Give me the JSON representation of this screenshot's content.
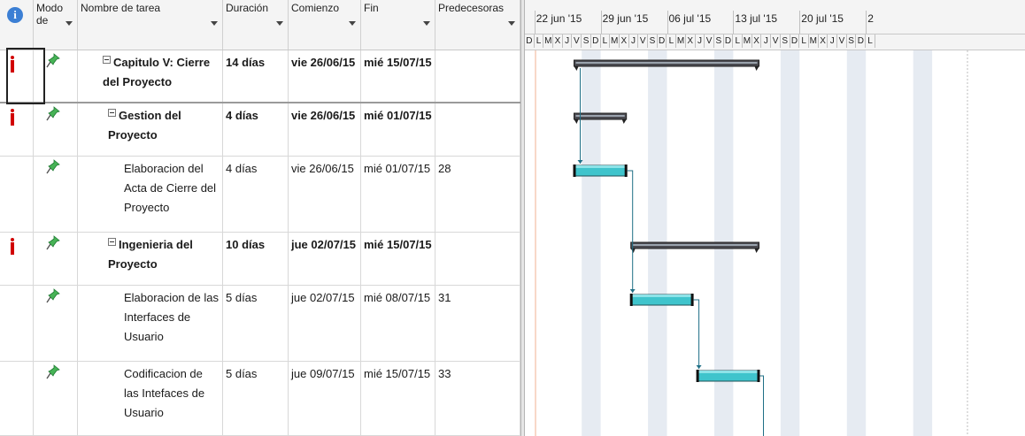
{
  "columns": {
    "info_icon": "i",
    "mode": "Modo de",
    "task_name": "Nombre de tarea",
    "duration": "Duración",
    "start": "Comienzo",
    "finish": "Fin",
    "predecessors": "Predecesoras"
  },
  "timeline": {
    "weeks": [
      "22 jun '15",
      "29 jun '15",
      "06 jul '15",
      "13 jul '15",
      "20 jul '15",
      "2"
    ],
    "days": [
      "D",
      "L",
      "M",
      "X",
      "J",
      "V",
      "S",
      "D",
      "L",
      "M",
      "X",
      "J",
      "V",
      "S",
      "D",
      "L",
      "M",
      "X",
      "J",
      "V",
      "S",
      "D",
      "L",
      "M",
      "X",
      "J",
      "V",
      "S",
      "D",
      "L",
      "M",
      "X",
      "J",
      "V",
      "S",
      "D",
      "L"
    ]
  },
  "tasks": [
    {
      "name": "Capitulo V: Cierre del Proyecto",
      "duration": "14 días",
      "start": "vie 26/06/15",
      "finish": "mié 15/07/15",
      "pred": "",
      "summary": true,
      "indicator": true
    },
    {
      "name": "Gestion del Proyecto",
      "duration": "4 días",
      "start": "vie 26/06/15",
      "finish": "mié 01/07/15",
      "pred": "",
      "summary": true,
      "indicator": true
    },
    {
      "name": "Elaboracion del Acta de Cierre del Proyecto",
      "duration": "4 días",
      "start": "vie 26/06/15",
      "finish": "mié 01/07/15",
      "pred": "28",
      "summary": false,
      "indicator": false
    },
    {
      "name": "Ingenieria del Proyecto",
      "duration": "10 días",
      "start": "jue 02/07/15",
      "finish": "mié 15/07/15",
      "pred": "",
      "summary": true,
      "indicator": true
    },
    {
      "name": "Elaboracion de las Interfaces de Usuario",
      "duration": "5 días",
      "start": "jue 02/07/15",
      "finish": "mié 08/07/15",
      "pred": "31",
      "summary": false,
      "indicator": false
    },
    {
      "name": "Codificacion de las Intefaces de Usuario",
      "duration": "5 días",
      "start": "jue 09/07/15",
      "finish": "mié 15/07/15",
      "pred": "33",
      "summary": false,
      "indicator": false
    }
  ],
  "colors": {
    "summary_bar": "#4a4a50",
    "task_bar": "#3fc4cc",
    "link": "#1f6f86",
    "nonwork": "#e6ebf2"
  }
}
